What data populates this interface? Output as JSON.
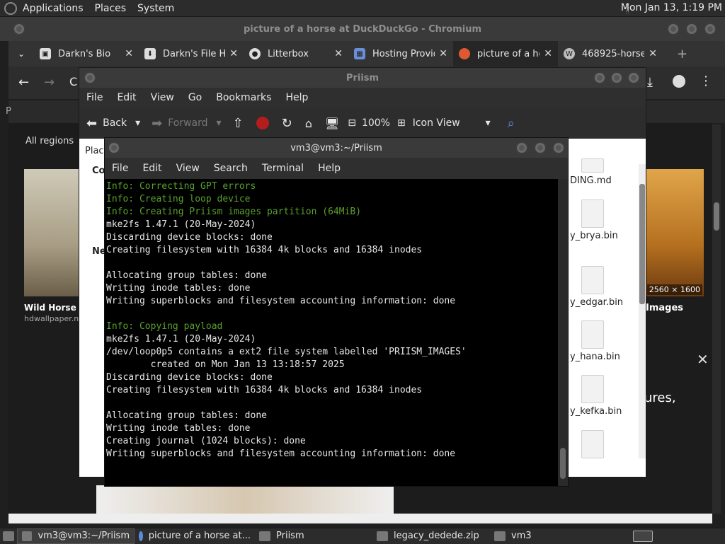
{
  "top_panel": {
    "menus": [
      "Applications",
      "Places",
      "System"
    ],
    "clock": "Mon Jan 13,  1:19 PM"
  },
  "chromium": {
    "title": "picture of a horse at DuckDuckGo - Chromium",
    "tabs": [
      {
        "label": "Darkn's Bio",
        "icon": "darkn-bio-favicon"
      },
      {
        "label": "Darkn's File Ho",
        "icon": "download-favicon"
      },
      {
        "label": "Litterbox",
        "icon": "litterbox-favicon"
      },
      {
        "label": "Hosting Provid",
        "icon": "hosting-favicon"
      },
      {
        "label": "picture of a ho",
        "icon": "duckduckgo-favicon"
      },
      {
        "label": "468925-horse",
        "icon": "wordpress-favicon"
      }
    ],
    "new_tab": "+",
    "page": {
      "all_regions": "All regions",
      "left_result_title": "Wild Horse W",
      "left_result_source": "hdwallpaper.n",
      "right_result_title": "Images",
      "right_result_res": "2560 × 1600",
      "right_snippet": "ures,"
    }
  },
  "priism": {
    "title": "Priism",
    "menu": [
      "File",
      "Edit",
      "View",
      "Go",
      "Bookmarks",
      "Help"
    ],
    "toolbar": {
      "back": "Back",
      "forward": "Forward",
      "zoom": "100%",
      "view_mode": "Icon View"
    },
    "sidebar_fragments": [
      "Plac",
      "Co",
      "Ne"
    ],
    "files": [
      {
        "name": "DING.md"
      },
      {
        "name": "y_brya.bin"
      },
      {
        "name": "y_edgar.bin"
      },
      {
        "name": "y_hana.bin"
      },
      {
        "name": "y_kefka.bin"
      }
    ]
  },
  "terminal": {
    "title": "vm3@vm3:~/Priism",
    "menu": [
      "File",
      "Edit",
      "View",
      "Search",
      "Terminal",
      "Help"
    ],
    "lines": [
      {
        "text": "Info: Correcting GPT errors",
        "kind": "info"
      },
      {
        "text": "Info: Creating loop device",
        "kind": "info"
      },
      {
        "text": "Info: Creating Priism images partition (64MiB)",
        "kind": "info"
      },
      {
        "text": "mke2fs 1.47.1 (20-May-2024)",
        "kind": "normal"
      },
      {
        "text": "Discarding device blocks: done",
        "kind": "normal"
      },
      {
        "text": "Creating filesystem with 16384 4k blocks and 16384 inodes",
        "kind": "normal"
      },
      {
        "text": "",
        "kind": "normal"
      },
      {
        "text": "Allocating group tables: done",
        "kind": "normal"
      },
      {
        "text": "Writing inode tables: done",
        "kind": "normal"
      },
      {
        "text": "Writing superblocks and filesystem accounting information: done",
        "kind": "normal"
      },
      {
        "text": "",
        "kind": "normal"
      },
      {
        "text": "Info: Copying payload",
        "kind": "info"
      },
      {
        "text": "mke2fs 1.47.1 (20-May-2024)",
        "kind": "normal"
      },
      {
        "text": "/dev/loop0p5 contains a ext2 file system labelled 'PRIISM_IMAGES'",
        "kind": "normal"
      },
      {
        "text": "        created on Mon Jan 13 13:18:57 2025",
        "kind": "normal"
      },
      {
        "text": "Discarding device blocks: done",
        "kind": "normal"
      },
      {
        "text": "Creating filesystem with 16384 4k blocks and 16384 inodes",
        "kind": "normal"
      },
      {
        "text": "",
        "kind": "normal"
      },
      {
        "text": "Allocating group tables: done",
        "kind": "normal"
      },
      {
        "text": "Writing inode tables: done",
        "kind": "normal"
      },
      {
        "text": "Creating journal (1024 blocks): done",
        "kind": "normal"
      },
      {
        "text": "Writing superblocks and filesystem accounting information: done",
        "kind": "normal"
      }
    ]
  },
  "taskbar": {
    "items": [
      {
        "label": "vm3@vm3:~/Priism",
        "icon": "terminal-icon",
        "active": true
      },
      {
        "label": "picture of a horse at...",
        "icon": "chromium-icon",
        "active": false
      },
      {
        "label": "Priism",
        "icon": "folder-icon",
        "active": false
      },
      {
        "label": "legacy_dedede.zip",
        "icon": "archive-icon",
        "active": false
      },
      {
        "label": "vm3",
        "icon": "folder-icon",
        "active": false
      }
    ]
  },
  "colors": {
    "terminal_info": "#5aa02c",
    "terminal_bg": "#000000",
    "panel_bg": "#2c2c2c"
  }
}
